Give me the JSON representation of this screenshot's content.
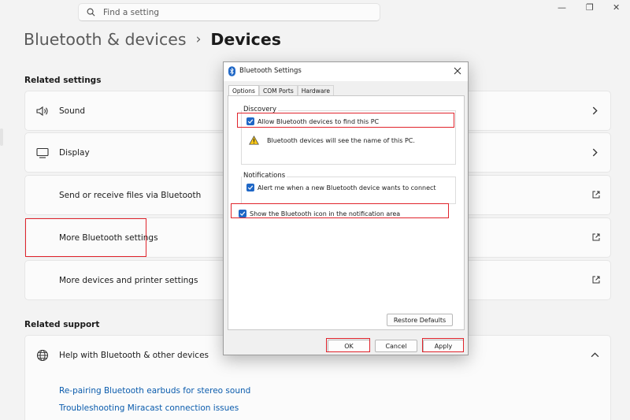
{
  "search": {
    "placeholder": "Find a setting",
    "icon": "search-icon"
  },
  "breadcrumb": {
    "parent": "Bluetooth & devices",
    "separator": "›",
    "current": "Devices"
  },
  "related_settings": {
    "heading": "Related settings",
    "items": [
      {
        "label": "Sound",
        "icon": "speaker-icon",
        "action": "chevron"
      },
      {
        "label": "Display",
        "icon": "monitor-icon",
        "action": "chevron"
      },
      {
        "label": "Send or receive files via Bluetooth",
        "action": "external-link"
      },
      {
        "label": "More Bluetooth settings",
        "action": "external-link",
        "highlighted": true
      },
      {
        "label": "More devices and printer settings",
        "action": "external-link"
      }
    ]
  },
  "related_support": {
    "heading": "Related support",
    "help_item": {
      "label": "Help with Bluetooth & other devices",
      "icon": "globe-icon",
      "state": "expanded"
    },
    "links": [
      "Re-pairing Bluetooth earbuds for stereo sound",
      "Troubleshooting Miracast connection issues"
    ]
  },
  "dialog": {
    "title": "Bluetooth Settings",
    "tabs": [
      "Options",
      "COM Ports",
      "Hardware"
    ],
    "active_tab": "Options",
    "discovery": {
      "title": "Discovery",
      "allow_label": "Allow Bluetooth devices to find this PC",
      "allow_checked": true,
      "warning": "Bluetooth devices will see the name of this PC."
    },
    "notifications": {
      "title": "Notifications",
      "alert_label": "Alert me when a new Bluetooth device wants to connect",
      "alert_checked": true
    },
    "show_icon_label": "Show the Bluetooth icon in the notification area",
    "show_icon_checked": true,
    "buttons": {
      "restore": "Restore Defaults",
      "ok": "OK",
      "cancel": "Cancel",
      "apply": "Apply"
    }
  },
  "colors": {
    "highlight": "#e0242c",
    "link": "#0b5cad",
    "checkbox": "#1f67c6",
    "bluetooth": "#1f67c6"
  }
}
